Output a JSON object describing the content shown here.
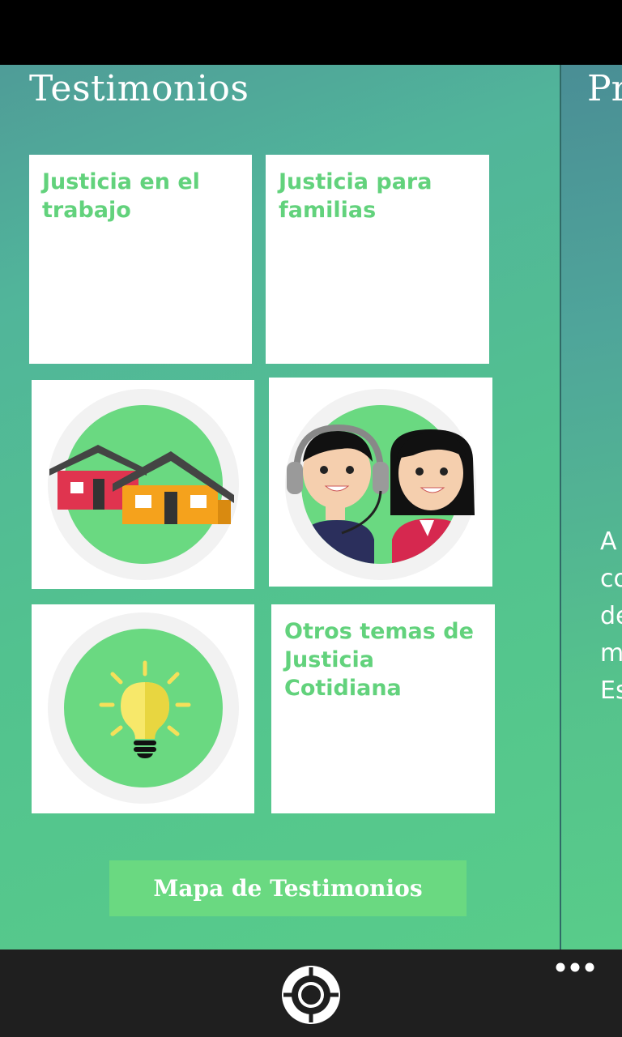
{
  "section": {
    "title": "Testimonios",
    "next_title": "Pr",
    "next_text_lines": [
      "A",
      "co",
      "de",
      "m",
      "Es"
    ]
  },
  "tiles": {
    "work": "Justicia en el trabajo",
    "families": "Justicia para familias",
    "housing_icon": "houses-icon",
    "help_icon": "helpline-people-icon",
    "idea_icon": "lightbulb-icon",
    "other": "Otros temas de Justicia Cotidiana"
  },
  "map_button": {
    "label": "Mapa de Testimonios"
  },
  "colors": {
    "accent": "#62d27c",
    "panel_green": "#52c28f",
    "button_green": "#6ad981",
    "app_bar": "#1f1f1f"
  }
}
